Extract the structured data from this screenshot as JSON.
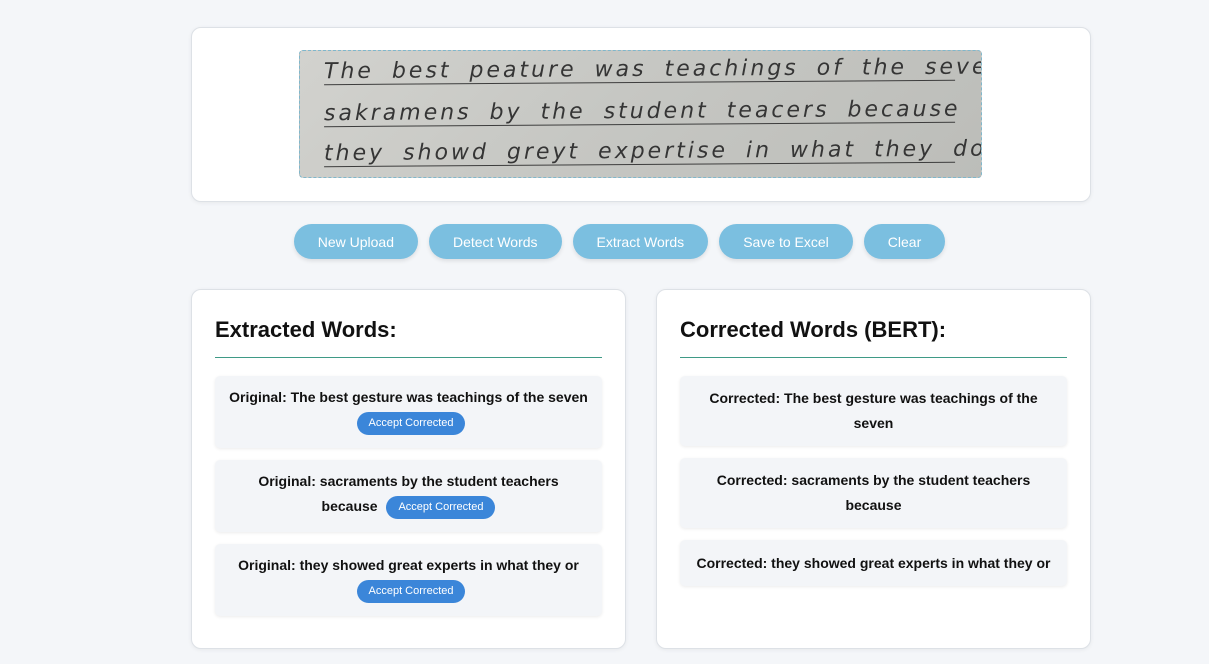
{
  "image": {
    "handwriting_lines": [
      "The best peature was teachings of the seven",
      "sakramens by the student teacers because",
      "they showd greyt expertise in what they do"
    ]
  },
  "toolbar": {
    "buttons": [
      "New Upload",
      "Detect Words",
      "Extract Words",
      "Save to Excel",
      "Clear"
    ]
  },
  "extracted": {
    "title": "Extracted Words:",
    "accept_label": "Accept Corrected",
    "items": [
      "Original: The best gesture was teachings of the seven",
      "Original: sacraments by the student teachers because",
      "Original: they showed great experts in what they or"
    ]
  },
  "corrected": {
    "title": "Corrected Words (BERT):",
    "items": [
      "Corrected: The best gesture was teachings of the seven",
      "Corrected: sacraments by the student teachers because",
      "Corrected: they showed great experts in what they or"
    ]
  },
  "colors": {
    "button_bg": "#7bbfe0",
    "accept_bg": "#3b86d9",
    "divider": "#3f9a86",
    "page_bg": "#f4f6f9"
  }
}
